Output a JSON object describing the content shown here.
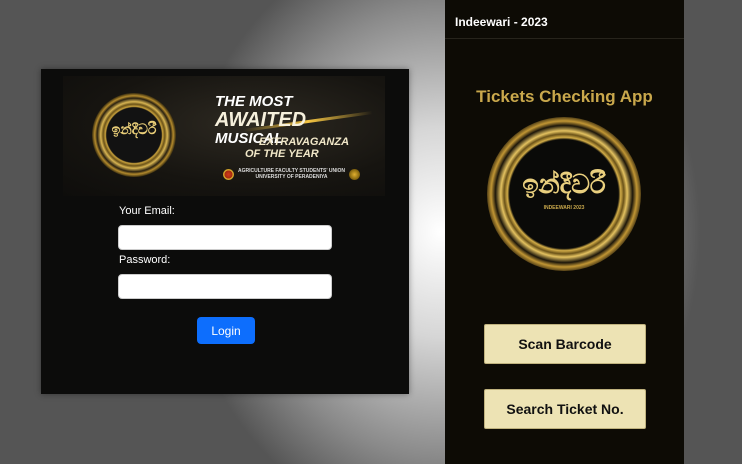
{
  "login": {
    "banner": {
      "logo_text": "ඉන්දීවරී",
      "line1": "THE MOST",
      "line2": "AWAITED",
      "line3": "MUSICAL",
      "line3b": "EXTRAVAGANZA",
      "line4": "OF THE YEAR",
      "union_line1": "AGRICULTURE FACULTY STUDENTS' UNION",
      "union_line2": "UNIVERSITY OF PERADENIYA"
    },
    "email_label": "Your Email:",
    "email_value": "",
    "password_label": "Password:",
    "password_value": "",
    "login_button": "Login"
  },
  "app": {
    "header_title": "Indeewari - 2023",
    "title": "Tickets Checking App",
    "logo_text": "ඉන්දීවරී",
    "logo_sub": "INDEEWARI 2023",
    "scan_button": "Scan Barcode",
    "search_button": "Search Ticket No."
  },
  "colors": {
    "primary_blue": "#0d6efd",
    "gold": "#c9a84c",
    "button_cream": "#ede3b4",
    "panel_dark": "#0d0b05"
  }
}
